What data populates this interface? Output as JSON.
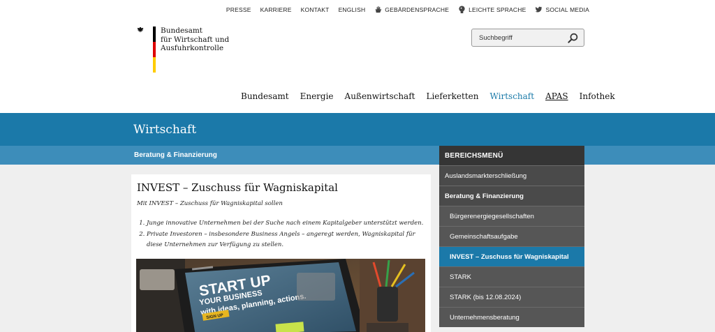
{
  "utility_nav": [
    {
      "label": "PRESSE",
      "icon": ""
    },
    {
      "label": "KARRIERE",
      "icon": ""
    },
    {
      "label": "KONTAKT",
      "icon": ""
    },
    {
      "label": "ENGLISH",
      "icon": ""
    },
    {
      "label": "GEBÄRDENSPRACHE",
      "icon": "sign-language-hand-icon"
    },
    {
      "label": "LEICHTE SPRACHE",
      "icon": "easy-language-head-icon"
    },
    {
      "label": "SOCIAL MEDIA",
      "icon": "twitter-bird-icon"
    }
  ],
  "logo": {
    "line1": "Bundesamt",
    "line2": "für Wirtschaft und",
    "line3": "Ausfuhrkontrolle",
    "flag_colors": [
      "#000000",
      "#dd0000",
      "#ffcc00"
    ]
  },
  "search": {
    "placeholder": "Suchbegriff",
    "icon": "magnifier-icon"
  },
  "main_nav": [
    {
      "label": "Bundesamt",
      "active": false
    },
    {
      "label": "Energie",
      "active": false
    },
    {
      "label": "Außenwirtschaft",
      "active": false
    },
    {
      "label": "Lieferketten",
      "active": false
    },
    {
      "label": "Wirtschaft",
      "active": true
    },
    {
      "label": "APAS",
      "active": false
    },
    {
      "label": "Infothek",
      "active": false
    }
  ],
  "section_title": "Wirtschaft",
  "subsection_title": "Beratung & Finanzierung",
  "article": {
    "title": "INVEST – Zuschuss für Wagniskapital",
    "intro": "Mit INVEST – Zuschuss für Wagniskapital sollen",
    "list": [
      "Junge innovative Unternehmen bei der Suche nach einem Kapitalgeber unterstützt werden.",
      "Private Investoren – insbesondere Business Angels – angeregt werden, Wagniskapital für diese Unternehmen zur Verfügung zu stellen."
    ],
    "image_text": {
      "small": "START UP",
      "big": "START UP",
      "line2": "YOUR BUSINESS",
      "line3": "with ideas, planning, actions.",
      "button": "SIGN UP"
    }
  },
  "side_menu": {
    "header": "BEREICHSMENÜ",
    "items": [
      {
        "label": "Auslandsmarkterschließung",
        "level": 1,
        "active": false
      },
      {
        "label": "Beratung & Finanzierung",
        "level": 1,
        "active": false,
        "bold": true
      },
      {
        "label": "Bürgerenergiegesellschaften",
        "level": 2,
        "active": false
      },
      {
        "label": "Gemeinschaftsaufgabe",
        "level": 2,
        "active": false
      },
      {
        "label": "INVEST – Zuschuss für Wagniskapital",
        "level": 2,
        "active": true
      },
      {
        "label": "STARK",
        "level": 2,
        "active": false
      },
      {
        "label": "STARK (bis 12.08.2024)",
        "level": 2,
        "active": false
      },
      {
        "label": "Unternehmensberatung",
        "level": 2,
        "active": false
      }
    ]
  },
  "colors": {
    "primary_blue": "#1b79a9",
    "secondary_blue": "#3d8dba",
    "menu_dark": "#353535",
    "menu_gray": "#4a4a4a"
  }
}
